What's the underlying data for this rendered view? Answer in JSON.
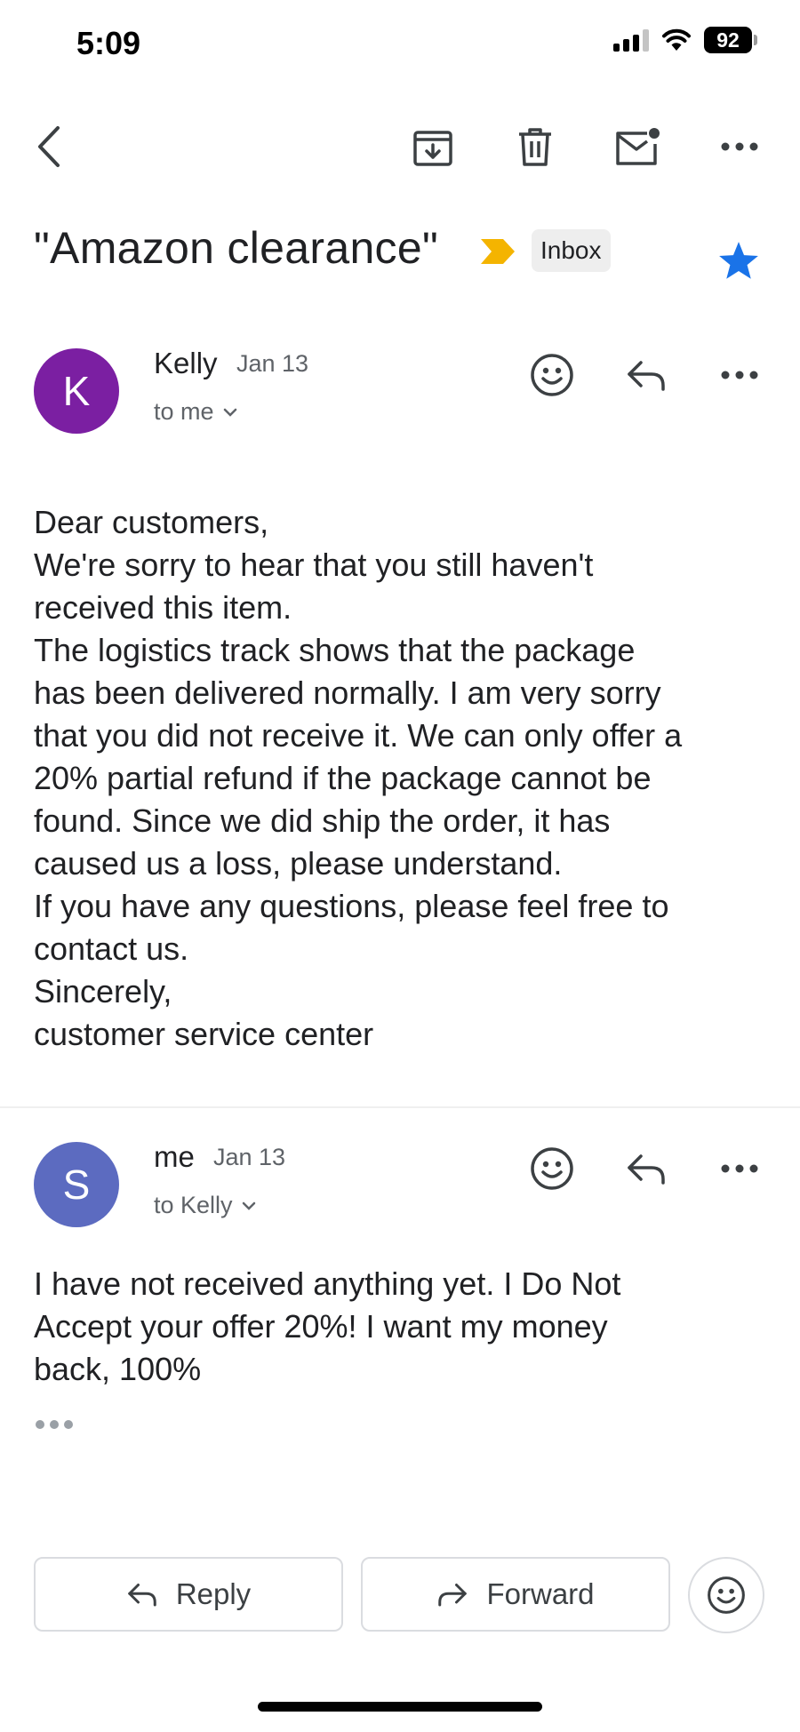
{
  "status_bar": {
    "time": "5:09",
    "battery": "92"
  },
  "toolbar": {
    "back_icon": "chevron-left-icon",
    "archive_icon": "archive-icon",
    "delete_icon": "trash-icon",
    "unread_icon": "mark-unread-icon",
    "more_icon": "more-horizontal-icon"
  },
  "subject": {
    "text": "\"Amazon clearance\"",
    "label": "Inbox",
    "importance_color": "#F4B400",
    "starred": true,
    "star_color": "#1A73E8"
  },
  "messages": [
    {
      "avatar_letter": "K",
      "avatar_color": "#7B1FA2",
      "sender": "Kelly",
      "date": "Jan 13",
      "recipient": "to me",
      "body_lines": [
        "Dear customers,",
        "We're sorry to hear that you still haven't",
        "received this item.",
        "The logistics track shows that the package",
        "has been delivered normally. I am very sorry",
        "that you did not receive it. We can only offer a",
        "20% partial refund if the package cannot be",
        "found. Since we did ship the order, it has",
        "caused us a loss, please understand.",
        "If you have any questions, please feel free to",
        "contact us.",
        "Sincerely,",
        "customer service center"
      ]
    },
    {
      "avatar_letter": "S",
      "avatar_color": "#5C6BC0",
      "sender": "me",
      "date": "Jan 13",
      "recipient": "to Kelly",
      "body_lines": [
        "I have not received anything yet.  I Do Not",
        "Accept your offer 20%!  I want my money",
        "back, 100%"
      ]
    }
  ],
  "actions": {
    "reply_label": "Reply",
    "forward_label": "Forward"
  }
}
